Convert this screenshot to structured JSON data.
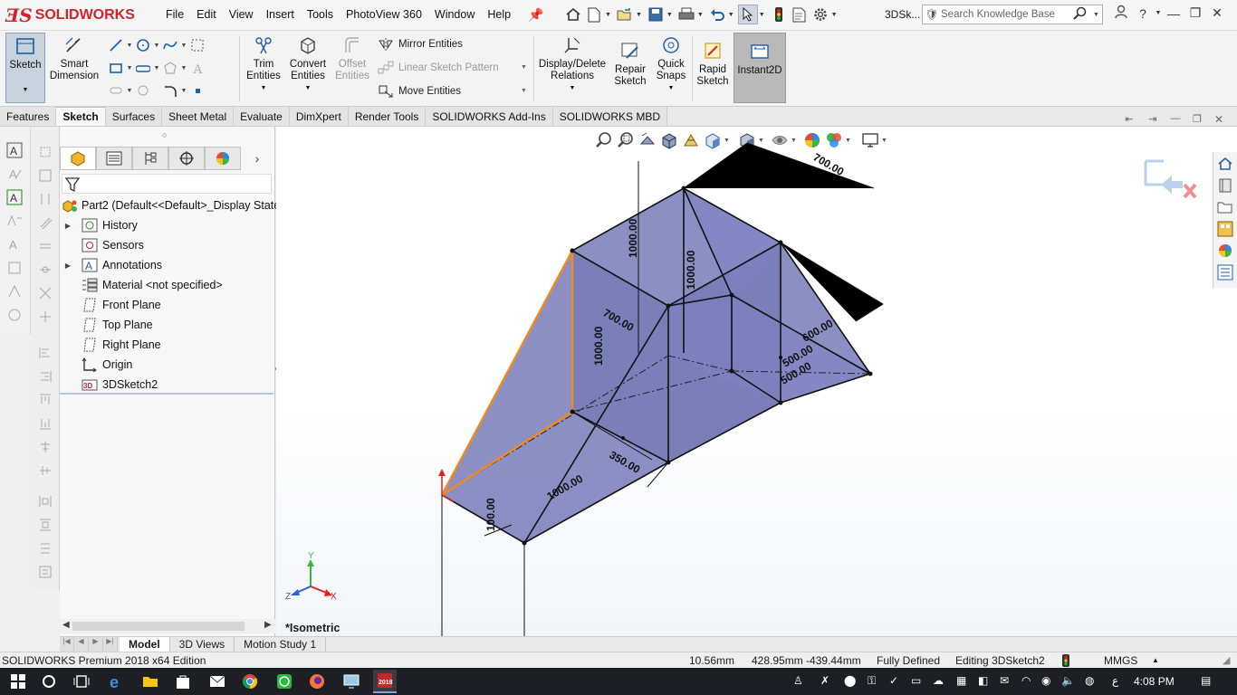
{
  "app": {
    "title": "SOLIDWORKS",
    "document": "3DSk...",
    "menus": [
      "File",
      "Edit",
      "View",
      "Insert",
      "Tools",
      "PhotoView 360",
      "Window",
      "Help"
    ],
    "search_placeholder": "Search Knowledge Base",
    "help_label": "?"
  },
  "ribbon": {
    "sketch": "Sketch",
    "smart_dimension": [
      "Smart",
      "Dimension"
    ],
    "trim_entities": [
      "Trim",
      "Entities"
    ],
    "convert_entities": [
      "Convert",
      "Entities"
    ],
    "offset_entities": [
      "Offset",
      "Entities"
    ],
    "mirror_entities": "Mirror Entities",
    "linear_sketch_pattern": "Linear Sketch Pattern",
    "move_entities": "Move Entities",
    "display_delete_relations": [
      "Display/Delete",
      "Relations"
    ],
    "repair_sketch": [
      "Repair",
      "Sketch"
    ],
    "quick_snaps": [
      "Quick",
      "Snaps"
    ],
    "rapid_sketch": [
      "Rapid",
      "Sketch"
    ],
    "instant2d": "Instant2D"
  },
  "command_tabs": [
    "Features",
    "Sketch",
    "Surfaces",
    "Sheet Metal",
    "Evaluate",
    "DimXpert",
    "Render Tools",
    "SOLIDWORKS Add-Ins",
    "SOLIDWORKS MBD"
  ],
  "active_command_tab": "Sketch",
  "feature_tree": {
    "root": "Part2  (Default<<Default>_Display State",
    "items": [
      {
        "label": "History",
        "icon": "history-icon",
        "expandable": true
      },
      {
        "label": "Sensors",
        "icon": "sensors-icon",
        "expandable": false
      },
      {
        "label": "Annotations",
        "icon": "annotations-icon",
        "expandable": true
      },
      {
        "label": "Material <not specified>",
        "icon": "material-icon",
        "expandable": false
      },
      {
        "label": "Front Plane",
        "icon": "plane-icon",
        "expandable": false
      },
      {
        "label": "Top Plane",
        "icon": "plane-icon",
        "expandable": false
      },
      {
        "label": "Right Plane",
        "icon": "plane-icon",
        "expandable": false
      },
      {
        "label": "Origin",
        "icon": "origin-icon",
        "expandable": false
      },
      {
        "label": "3DSketch2",
        "icon": "3dsketch-icon",
        "expandable": false
      }
    ]
  },
  "viewport": {
    "view_name": "*Isometric",
    "dimensions": [
      "700.00",
      "1000.00",
      "1000.00",
      "700.00",
      "1000.00",
      "600.00",
      "500.00",
      "500.00",
      "350.00",
      "1000.00",
      "100.00"
    ],
    "model_face_color": "#6b6fb3",
    "highlight_color": "#f08a1c",
    "triad": {
      "x": "X",
      "y": "Y",
      "z": "Z"
    }
  },
  "model_tabs": [
    "Model",
    "3D Views",
    "Motion Study 1"
  ],
  "active_model_tab": "Model",
  "status": {
    "product": "SOLIDWORKS Premium 2018 x64 Edition",
    "length": "10.56mm",
    "coords": "428.95mm -439.44mm",
    "state": "Fully Defined",
    "editing": "Editing 3DSketch2",
    "units": "MMGS"
  },
  "taskbar": {
    "time": "4:08 PM",
    "lang": "ع"
  }
}
